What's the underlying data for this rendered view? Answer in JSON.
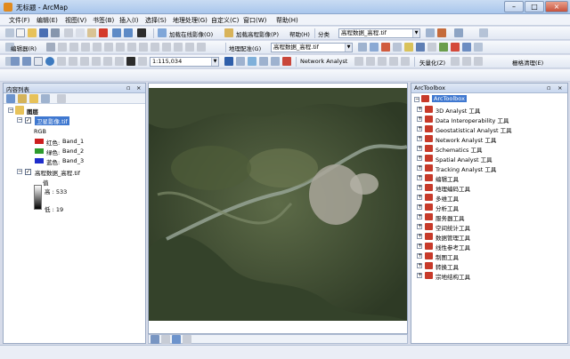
{
  "window": {
    "title": "无标题 - ArcMap",
    "min": "–",
    "max": "□",
    "close": "×"
  },
  "menu": [
    "文件(F)",
    "编辑(E)",
    "视图(V)",
    "书签(B)",
    "插入(I)",
    "选择(S)",
    "地理处理(G)",
    "自定义(C)",
    "窗口(W)",
    "帮助(H)"
  ],
  "toolbar1": {
    "online_imagery": "加载在线影像(O)",
    "elevation_imagery": "加载高程影像(P)",
    "help": "帮助(H)",
    "classify": "分类",
    "classify_layer": "高程数据_高程.tif"
  },
  "toolbar2": {
    "editor": "编辑器(R)",
    "georef": "地理配准(G)",
    "georef_layer": "高程数据_高程.tif"
  },
  "toolbar3": {
    "scale": "1:115,034",
    "network_analyst": "Network Analyst",
    "vectorize": "矢量化(Z)",
    "raster_clean": "栅格清理(E)"
  },
  "toc": {
    "title": "内容列表",
    "root": "图层",
    "layer1": {
      "name": "卫星影像.tif",
      "sub": "RGB",
      "bands": [
        {
          "label": "红色:",
          "band": "Band_1",
          "color": "#cc1f1f"
        },
        {
          "label": "绿色:",
          "band": "Band_2",
          "color": "#2e9b2e"
        },
        {
          "label": "蓝色:",
          "band": "Band_3",
          "color": "#1f2ecc"
        }
      ]
    },
    "layer2": {
      "name": "高程数据_高程.tif",
      "value_label": "值",
      "high": "高 : 533",
      "low": "低 : 19"
    }
  },
  "arctoolbox": {
    "title": "ArcToolbox",
    "root": "ArcToolbox",
    "items": [
      "3D Analyst 工具",
      "Data Interoperability 工具",
      "Geostatistical Analyst 工具",
      "Network Analyst 工具",
      "Schematics 工具",
      "Spatial Analyst 工具",
      "Tracking Analyst 工具",
      "编辑工具",
      "地理编码工具",
      "多维工具",
      "分析工具",
      "服务器工具",
      "空间统计工具",
      "数据管理工具",
      "线性参考工具",
      "制图工具",
      "转换工具",
      "宗地结构工具"
    ]
  }
}
